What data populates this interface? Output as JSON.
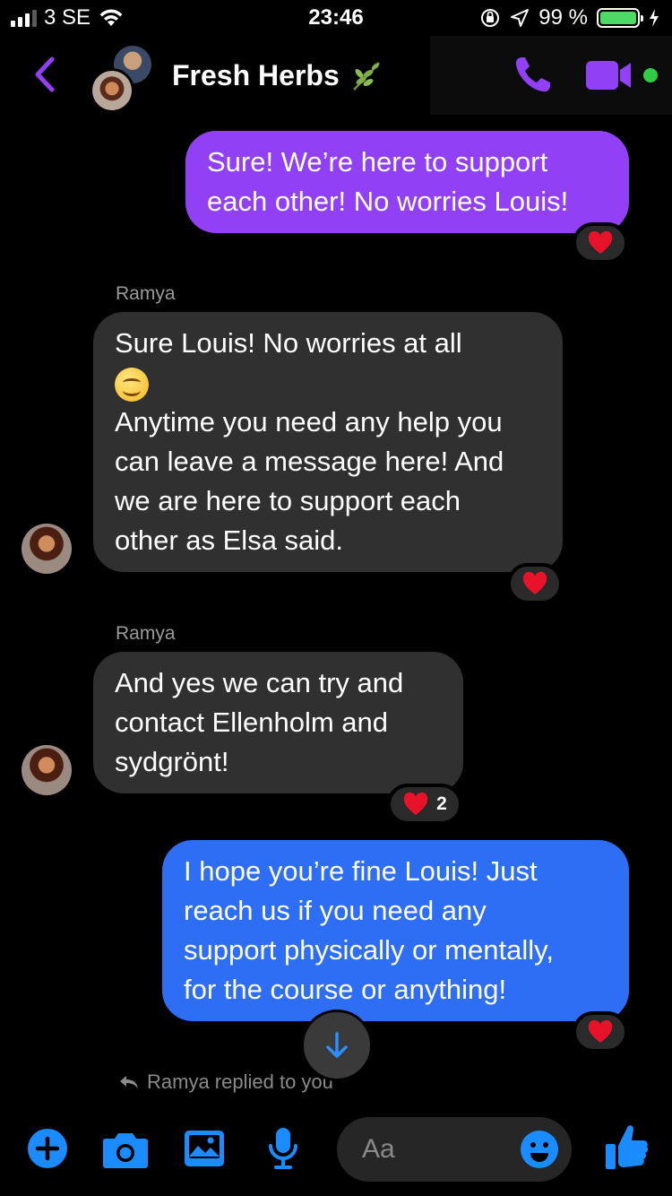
{
  "status_bar": {
    "carrier": "3 SE",
    "time": "23:46",
    "battery": "99 %",
    "battery_level": 0.99
  },
  "header": {
    "title": "Fresh Herbs",
    "title_emoji": "herb",
    "accent_color": "#9140f5"
  },
  "messages": [
    {
      "direction": "outgoing",
      "lines": [
        "Sure! We’re here to support",
        "each other! No worries Louis!"
      ],
      "reaction": "❤"
    },
    {
      "direction": "incoming",
      "sender": "Ramya",
      "lines": [
        "Sure Louis! No worries at all",
        "Anytime you need any help you",
        "can leave a message here! And",
        "we are here to support each",
        "other as Elsa said."
      ],
      "reaction": "❤"
    },
    {
      "direction": "incoming",
      "sender": "Ramya",
      "lines": [
        "And yes we can try and",
        "contact Ellenholm and",
        "sydgrönt!"
      ],
      "reaction": "❤",
      "reaction_count": "2"
    },
    {
      "direction": "outgoing",
      "lines": [
        "I hope you’re fine Louis! Just",
        "reach us if you need any",
        "support physically or mentally,",
        "for the course or anything!"
      ],
      "reaction": "❤"
    }
  ],
  "reply_notice": "Ramya replied to you",
  "composer": {
    "placeholder": "Aa"
  },
  "colors": {
    "purple_bubble": "#9140f5",
    "blue_bubble": "#2d6ef5",
    "incoming_bubble": "#303030",
    "icon_blue": "#1a8cff",
    "online": "#31cc46"
  }
}
